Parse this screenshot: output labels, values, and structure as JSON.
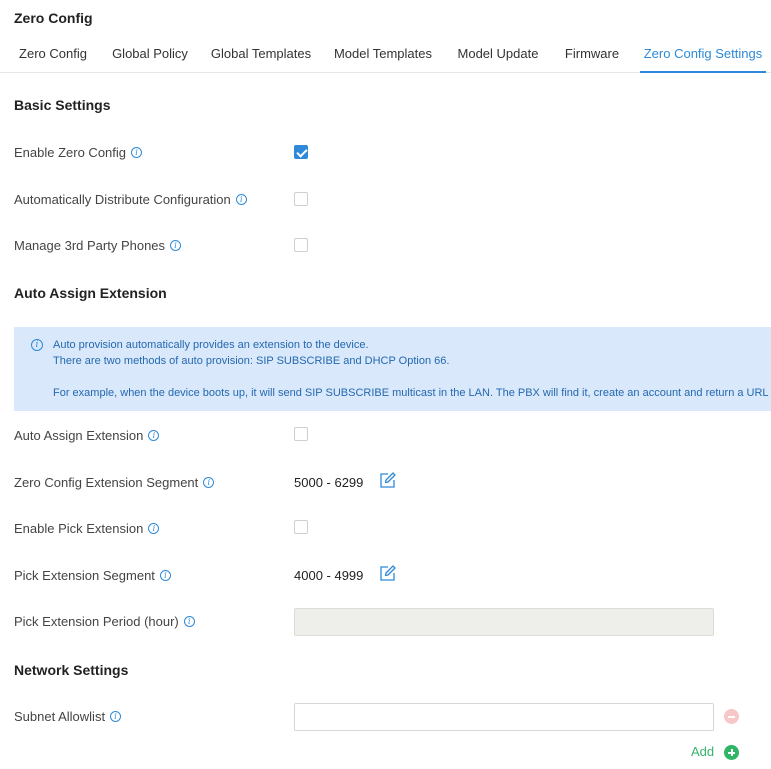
{
  "page": {
    "title": "Zero Config"
  },
  "tabs": [
    {
      "label": "Zero Config"
    },
    {
      "label": "Global Policy"
    },
    {
      "label": "Global Templates"
    },
    {
      "label": "Model Templates"
    },
    {
      "label": "Model Update"
    },
    {
      "label": "Firmware"
    },
    {
      "label": "Zero Config Settings",
      "active": true
    }
  ],
  "basic_settings": {
    "title": "Basic Settings",
    "enable_zero_config": {
      "label": "Enable Zero Config",
      "checked": true
    },
    "auto_distribute": {
      "label": "Automatically Distribute Configuration",
      "checked": false
    },
    "manage_3rd_party": {
      "label": "Manage 3rd Party Phones",
      "checked": false
    }
  },
  "auto_assign": {
    "title": "Auto Assign Extension",
    "notice": {
      "line1": "Auto provision automatically provides an extension to the device.",
      "line2": "There are two methods of auto provision: SIP SUBSCRIBE and DHCP Option 66.",
      "line3": "For example, when the device boots up, it will send SIP SUBSCRIBE multicast in the LAN. The PBX will find it, create an account and return a URL of the c"
    },
    "auto_assign_extension": {
      "label": "Auto Assign Extension",
      "checked": false
    },
    "zero_config_segment": {
      "label": "Zero Config Extension Segment",
      "value": "5000 - 6299"
    },
    "enable_pick": {
      "label": "Enable Pick Extension",
      "checked": false
    },
    "pick_segment": {
      "label": "Pick Extension Segment",
      "value": "4000 - 4999"
    },
    "pick_period": {
      "label": "Pick Extension Period (hour)",
      "value": ""
    }
  },
  "network": {
    "title": "Network Settings",
    "subnet_allowlist": {
      "label": "Subnet Allowlist",
      "value": ""
    },
    "add_label": "Add"
  },
  "colors": {
    "accent": "#2e8ad8",
    "add": "#2fb566",
    "remove": "#f7c6c6",
    "notice_bg": "#d9e9fb"
  }
}
